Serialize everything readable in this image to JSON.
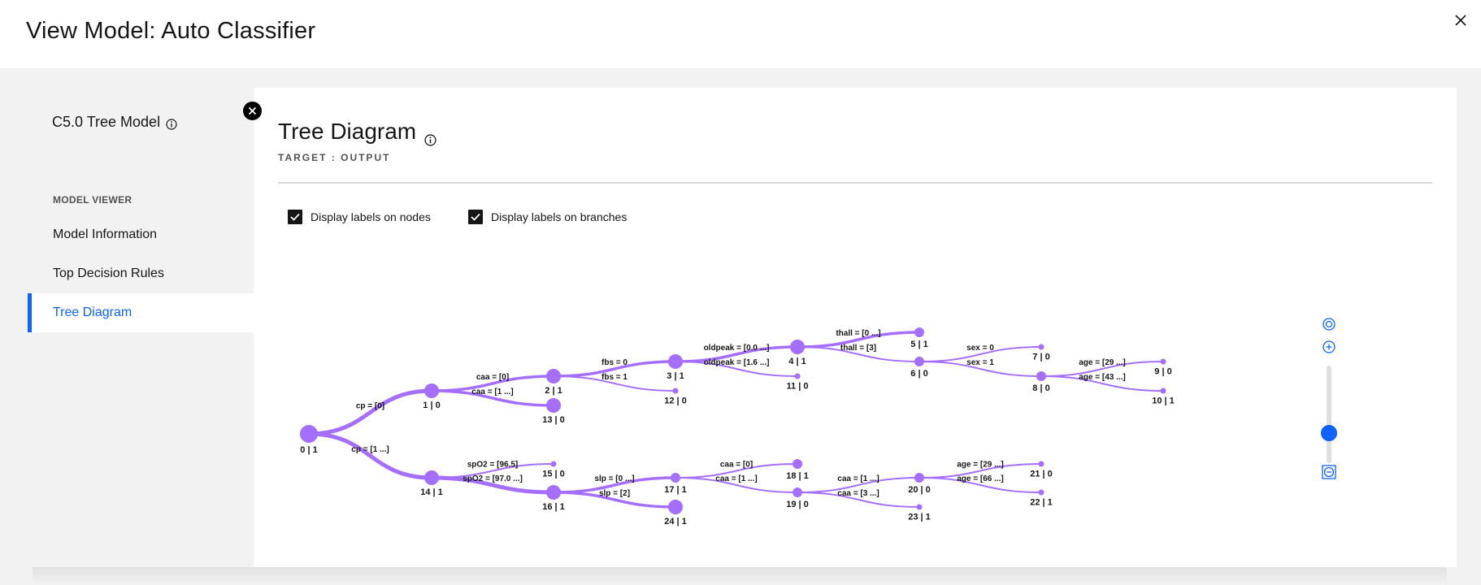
{
  "modal": {
    "title": "View Model: Auto Classifier"
  },
  "sidebar": {
    "model_title": "C5.0 Tree Model",
    "section_label": "MODEL VIEWER",
    "items": [
      {
        "label": "Model Information",
        "active": false
      },
      {
        "label": "Top Decision Rules",
        "active": false
      },
      {
        "label": "Tree Diagram",
        "active": true
      }
    ]
  },
  "panel": {
    "title": "Tree Diagram",
    "subtitle": "TARGET : OUTPUT",
    "checkbox_nodes_label": "Display labels on nodes",
    "checkbox_branches_label": "Display labels on branches"
  },
  "colors": {
    "accent": "#0f62fe",
    "tree": "#a56eff"
  },
  "tree": {
    "nodes": [
      {
        "id": "0",
        "label": "0 | 1",
        "size": 3
      },
      {
        "id": "1",
        "label": "1 | 0",
        "size": 2
      },
      {
        "id": "2",
        "label": "2 | 1",
        "size": 2
      },
      {
        "id": "3",
        "label": "3 | 1",
        "size": 2
      },
      {
        "id": "4",
        "label": "4 | 1",
        "size": 2
      },
      {
        "id": "5",
        "label": "5 | 1",
        "size": 1
      },
      {
        "id": "6",
        "label": "6 | 0",
        "size": 1
      },
      {
        "id": "7",
        "label": "7 | 0",
        "size": 0
      },
      {
        "id": "8",
        "label": "8 | 0",
        "size": 1
      },
      {
        "id": "9",
        "label": "9 | 0",
        "size": 0
      },
      {
        "id": "10",
        "label": "10 | 1",
        "size": 0
      },
      {
        "id": "11",
        "label": "11 | 0",
        "size": 0
      },
      {
        "id": "12",
        "label": "12 | 0",
        "size": 0
      },
      {
        "id": "13",
        "label": "13 | 0",
        "size": 2
      },
      {
        "id": "14",
        "label": "14 | 1",
        "size": 2
      },
      {
        "id": "15",
        "label": "15 | 0",
        "size": 0
      },
      {
        "id": "16",
        "label": "16 | 1",
        "size": 2
      },
      {
        "id": "17",
        "label": "17 | 1",
        "size": 1
      },
      {
        "id": "18",
        "label": "18 | 1",
        "size": 1
      },
      {
        "id": "19",
        "label": "19 | 0",
        "size": 1
      },
      {
        "id": "20",
        "label": "20 | 0",
        "size": 1
      },
      {
        "id": "21",
        "label": "21 | 0",
        "size": 0
      },
      {
        "id": "22",
        "label": "22 | 1",
        "size": 0
      },
      {
        "id": "23",
        "label": "23 | 1",
        "size": 0
      },
      {
        "id": "24",
        "label": "24 | 1",
        "size": 2
      }
    ],
    "edges": [
      {
        "from": "0",
        "to": "1",
        "label": "cp = [0]",
        "weight": 3
      },
      {
        "from": "0",
        "to": "14",
        "label": "cp = [1 ...]",
        "weight": 3
      },
      {
        "from": "1",
        "to": "2",
        "label": "caa = [0]",
        "weight": 2
      },
      {
        "from": "1",
        "to": "13",
        "label": "caa = [1 ...]",
        "weight": 2
      },
      {
        "from": "2",
        "to": "3",
        "label": "fbs = 0",
        "weight": 2
      },
      {
        "from": "2",
        "to": "12",
        "label": "fbs = 1",
        "weight": 1
      },
      {
        "from": "3",
        "to": "4",
        "label": "oldpeak = [0.0 ...]",
        "weight": 2
      },
      {
        "from": "3",
        "to": "11",
        "label": "oldpeak = [1.6 ...]",
        "weight": 1
      },
      {
        "from": "4",
        "to": "5",
        "label": "thall = [0 ...]",
        "weight": 2
      },
      {
        "from": "4",
        "to": "6",
        "label": "thall = [3]",
        "weight": 1
      },
      {
        "from": "6",
        "to": "7",
        "label": "sex = 0",
        "weight": 1
      },
      {
        "from": "6",
        "to": "8",
        "label": "sex = 1",
        "weight": 1
      },
      {
        "from": "8",
        "to": "9",
        "label": "age = [29 ...]",
        "weight": 1
      },
      {
        "from": "8",
        "to": "10",
        "label": "age = [43 ...]",
        "weight": 1
      },
      {
        "from": "14",
        "to": "15",
        "label": "spO2 = [96.5]",
        "weight": 1
      },
      {
        "from": "14",
        "to": "16",
        "label": "spO2 = [97.0 ...]",
        "weight": 3
      },
      {
        "from": "16",
        "to": "17",
        "label": "slp = [0 ...]",
        "weight": 2
      },
      {
        "from": "16",
        "to": "24",
        "label": "slp = [2]",
        "weight": 2
      },
      {
        "from": "17",
        "to": "18",
        "label": "caa = [0]",
        "weight": 1
      },
      {
        "from": "17",
        "to": "19",
        "label": "caa = [1 ...]",
        "weight": 1
      },
      {
        "from": "19",
        "to": "20",
        "label": "caa = [1 ...]",
        "weight": 1
      },
      {
        "from": "19",
        "to": "23",
        "label": "caa = [3 ...]",
        "weight": 1
      },
      {
        "from": "20",
        "to": "21",
        "label": "age = [29 ...]",
        "weight": 1
      },
      {
        "from": "20",
        "to": "22",
        "label": "age = [66 ...]",
        "weight": 1
      }
    ]
  },
  "zoom": {
    "level": 0.52
  },
  "icons": {
    "close": "close-icon",
    "info": "info-icon",
    "collapse": "close-circle-icon",
    "checkbox": "checkmark-icon",
    "recenter": "recenter-icon",
    "zoom_in": "zoom-in-icon",
    "zoom_out": "zoom-out-icon"
  }
}
